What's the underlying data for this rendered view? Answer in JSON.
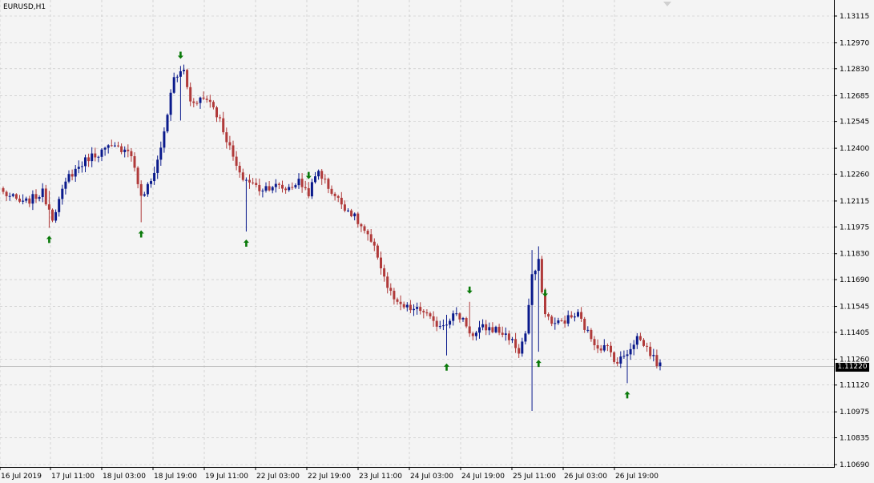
{
  "window": {
    "title": "EURUSD,H1"
  },
  "current_price_label": "1.11220",
  "colors": {
    "background": "#f4f4f4",
    "grid": "#c0c0c0",
    "bull": "#0a1a8c",
    "bear": "#b03a3a",
    "arrow": "#0a7a0a",
    "axis": "#000000"
  },
  "chart_data": {
    "type": "candlestick",
    "title": "EURUSD,H1",
    "y_ticks": [
      "1.13115",
      "1.12970",
      "1.12830",
      "1.12685",
      "1.12545",
      "1.12400",
      "1.12260",
      "1.12115",
      "1.11975",
      "1.11830",
      "1.11690",
      "1.11545",
      "1.11405",
      "1.11260",
      "1.11120",
      "1.10975",
      "1.10835",
      "1.10690"
    ],
    "x_ticks": [
      "16 Jul 2019",
      "17 Jul 11:00",
      "18 Jul 03:00",
      "18 Jul 19:00",
      "19 Jul 11:00",
      "22 Jul 03:00",
      "22 Jul 19:00",
      "23 Jul 11:00",
      "24 Jul 03:00",
      "24 Jul 19:00",
      "25 Jul 11:00",
      "26 Jul 03:00",
      "26 Jul 19:00"
    ],
    "ylim": [
      1.1069,
      1.13115
    ],
    "grid": true,
    "current_price": 1.1122,
    "anchors": [
      [
        0,
        1.1216
      ],
      [
        6,
        1.121
      ],
      [
        12,
        1.1216
      ],
      [
        15,
        1.1203
      ],
      [
        20,
        1.1225
      ],
      [
        26,
        1.1235
      ],
      [
        32,
        1.124
      ],
      [
        38,
        1.124
      ],
      [
        40,
        1.123
      ],
      [
        42,
        1.1213
      ],
      [
        45,
        1.1222
      ],
      [
        48,
        1.124
      ],
      [
        52,
        1.1278
      ],
      [
        55,
        1.1282
      ],
      [
        57,
        1.1265
      ],
      [
        60,
        1.1267
      ],
      [
        63,
        1.1266
      ],
      [
        66,
        1.1255
      ],
      [
        69,
        1.124
      ],
      [
        72,
        1.1225
      ],
      [
        75,
        1.1222
      ],
      [
        78,
        1.1218
      ],
      [
        82,
        1.122
      ],
      [
        86,
        1.1218
      ],
      [
        90,
        1.1222
      ],
      [
        93,
        1.1216
      ],
      [
        96,
        1.1228
      ],
      [
        99,
        1.1219
      ],
      [
        102,
        1.1212
      ],
      [
        106,
        1.1205
      ],
      [
        110,
        1.1195
      ],
      [
        114,
        1.1182
      ],
      [
        117,
        1.1165
      ],
      [
        120,
        1.1155
      ],
      [
        124,
        1.1153
      ],
      [
        128,
        1.1152
      ],
      [
        131,
        1.1145
      ],
      [
        134,
        1.1145
      ],
      [
        137,
        1.115
      ],
      [
        140,
        1.1148
      ],
      [
        143,
        1.1138
      ],
      [
        146,
        1.1143
      ],
      [
        150,
        1.1142
      ],
      [
        154,
        1.1138
      ],
      [
        157,
        1.113
      ],
      [
        159,
        1.114
      ],
      [
        161,
        1.117
      ],
      [
        163,
        1.1178
      ],
      [
        165,
        1.115
      ],
      [
        168,
        1.1145
      ],
      [
        172,
        1.1148
      ],
      [
        175,
        1.115
      ],
      [
        178,
        1.114
      ],
      [
        181,
        1.1133
      ],
      [
        184,
        1.1132
      ],
      [
        187,
        1.1124
      ],
      [
        190,
        1.113
      ],
      [
        193,
        1.1138
      ],
      [
        196,
        1.1132
      ],
      [
        199,
        1.1124
      ],
      [
        200,
        1.1122
      ]
    ],
    "arrows": [
      {
        "i": 14,
        "dir": "up"
      },
      {
        "i": 42,
        "dir": "up"
      },
      {
        "i": 54,
        "dir": "down"
      },
      {
        "i": 74,
        "dir": "up"
      },
      {
        "i": 93,
        "dir": "down"
      },
      {
        "i": 135,
        "dir": "up"
      },
      {
        "i": 142,
        "dir": "down"
      },
      {
        "i": 163,
        "dir": "up"
      },
      {
        "i": 165,
        "dir": "down"
      },
      {
        "i": 190,
        "dir": "up"
      }
    ]
  }
}
